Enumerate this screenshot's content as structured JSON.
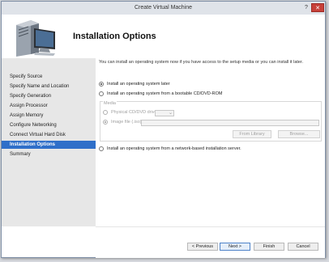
{
  "window": {
    "title": "Create Virtual Machine",
    "help_glyph": "?",
    "close_glyph": "✕"
  },
  "header": {
    "icon": "server-computer-icon",
    "title": "Installation Options"
  },
  "sidebar": {
    "items": [
      {
        "label": "Specify Source",
        "active": false
      },
      {
        "label": "Specify Name and Location",
        "active": false
      },
      {
        "label": "Specify Generation",
        "active": false
      },
      {
        "label": "Assign Processor",
        "active": false
      },
      {
        "label": "Assign Memory",
        "active": false
      },
      {
        "label": "Configure Networking",
        "active": false
      },
      {
        "label": "Connect Virtual Hard Disk",
        "active": false
      },
      {
        "label": "Installation Options",
        "active": true
      },
      {
        "label": "Summary",
        "active": false
      }
    ]
  },
  "content": {
    "intro": "You can install an operating system now if you have access to the setup media or you can install it later.",
    "options": [
      {
        "label": "Install an operating system later",
        "selected": true
      },
      {
        "label": "Install an operating system from a bootable CD/DVD-ROM",
        "selected": false
      },
      {
        "label": "Install an operating system from a network-based installation server.",
        "selected": false
      }
    ],
    "media": {
      "legend": "Media",
      "physical_label": "Physical CD/DVD drive:",
      "image_label": "Image file (.iso):",
      "physical_selected": false,
      "image_selected": true,
      "drive_value": "",
      "image_path": "",
      "from_library_label": "From Library",
      "browse_label": "Browse..."
    }
  },
  "footer": {
    "previous_label": "< Previous",
    "next_label": "Next >",
    "finish_label": "Finish",
    "cancel_label": "Cancel"
  },
  "colors": {
    "accent": "#2f6fc9",
    "close": "#c7413a",
    "sidebar_bg": "#e7e7e7"
  }
}
